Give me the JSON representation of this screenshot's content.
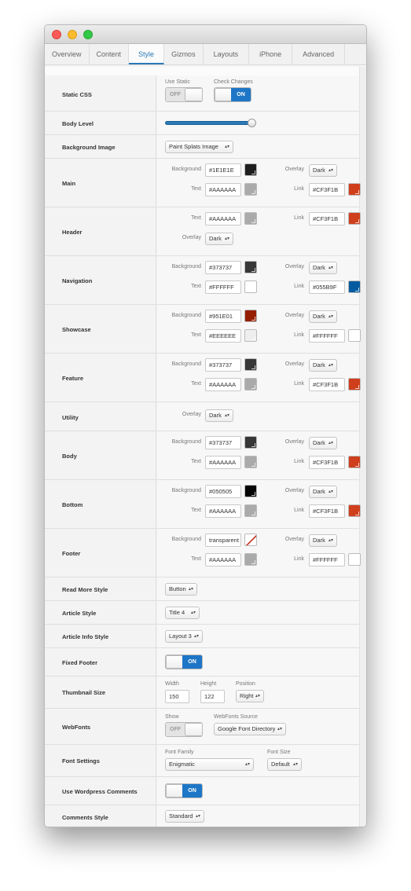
{
  "tabs": [
    "Overview",
    "Content",
    "Style",
    "Gizmos",
    "Layouts",
    "iPhone",
    "Advanced"
  ],
  "active_tab": "Style",
  "labels": {
    "background": "Background",
    "overlay": "Overlay",
    "text": "Text",
    "link": "Link",
    "use_static": "Use Static",
    "check_changes": "Check Changes",
    "width": "Width",
    "height": "Height",
    "position": "Position",
    "show": "Show",
    "webfonts_source": "WebFonts Source",
    "font_family": "Font Family",
    "font_size": "Font Size",
    "off": "OFF",
    "on": "ON"
  },
  "colors": {
    "main_background": "#1E1E1E",
    "main_text": "#AAAAAA",
    "main_link": "#CF3F1B",
    "header_text": "#AAAAAA",
    "header_link": "#CF3F1B",
    "navigation_background": "#373737",
    "navigation_text": "#FFFFFF",
    "navigation_link": "#055B9F",
    "showcase_background": "#951E01",
    "showcase_text": "#EEEEEE",
    "showcase_link": "#FFFFFF",
    "feature_background": "#373737",
    "feature_text": "#AAAAAA",
    "feature_link": "#CF3F1B",
    "body_background": "#373737",
    "body_text": "#AAAAAA",
    "body_link": "#CF3F1B",
    "bottom_background": "#050505",
    "bottom_text": "#AAAAAA",
    "bottom_link": "#CF3F1B",
    "footer_background": "transparent",
    "footer_text": "#AAAAAA",
    "footer_link": "#FFFFFF",
    "accent": "#1E76C6"
  },
  "rows": {
    "static_css": {
      "label": "Static CSS",
      "use_static": "OFF",
      "check_changes": "ON"
    },
    "body_level": {
      "label": "Body Level",
      "level": 0.97
    },
    "background_image": {
      "label": "Background Image",
      "value": "Paint Splats Image"
    },
    "main": {
      "label": "Main",
      "background": "#1E1E1E",
      "overlay": "Dark",
      "text": "#AAAAAA",
      "link": "#CF3F1B"
    },
    "header": {
      "label": "Header",
      "text": "#AAAAAA",
      "link": "#CF3F1B",
      "overlay": "Dark"
    },
    "navigation": {
      "label": "Navigation",
      "background": "#373737",
      "overlay": "Dark",
      "text": "#FFFFFF",
      "link": "#055B9F"
    },
    "showcase": {
      "label": "Showcase",
      "background": "#951E01",
      "overlay": "Dark",
      "text": "#EEEEEE",
      "link": "#FFFFFF"
    },
    "feature": {
      "label": "Feature",
      "background": "#373737",
      "overlay": "Dark",
      "text": "#AAAAAA",
      "link": "#CF3F1B"
    },
    "utility": {
      "label": "Utility",
      "overlay": "Dark"
    },
    "body": {
      "label": "Body",
      "background": "#373737",
      "overlay": "Dark",
      "text": "#AAAAAA",
      "link": "#CF3F1B"
    },
    "bottom": {
      "label": "Bottom",
      "background": "#050505",
      "overlay": "Dark",
      "text": "#AAAAAA",
      "link": "#CF3F1B"
    },
    "footer": {
      "label": "Footer",
      "background": "transparent",
      "overlay": "Dark",
      "text": "#AAAAAA",
      "link": "#FFFFFF"
    },
    "read_more_style": {
      "label": "Read More Style",
      "value": "Button"
    },
    "article_style": {
      "label": "Article Style",
      "value": "Title 4"
    },
    "article_info_style": {
      "label": "Article Info Style",
      "value": "Layout 3"
    },
    "fixed_footer": {
      "label": "Fixed Footer",
      "value": "ON"
    },
    "thumbnail_size": {
      "label": "Thumbnail Size",
      "width": "150",
      "height": "122",
      "position": "Right"
    },
    "webfonts": {
      "label": "WebFonts",
      "show": "OFF",
      "source": "Google Font Directory"
    },
    "font_settings": {
      "label": "Font Settings",
      "family": "Enigmatic",
      "size": "Default"
    },
    "use_wordpress_comments": {
      "label": "Use Wordpress Comments",
      "value": "ON"
    },
    "comments_style": {
      "label": "Comments Style",
      "value": "Standard"
    }
  }
}
